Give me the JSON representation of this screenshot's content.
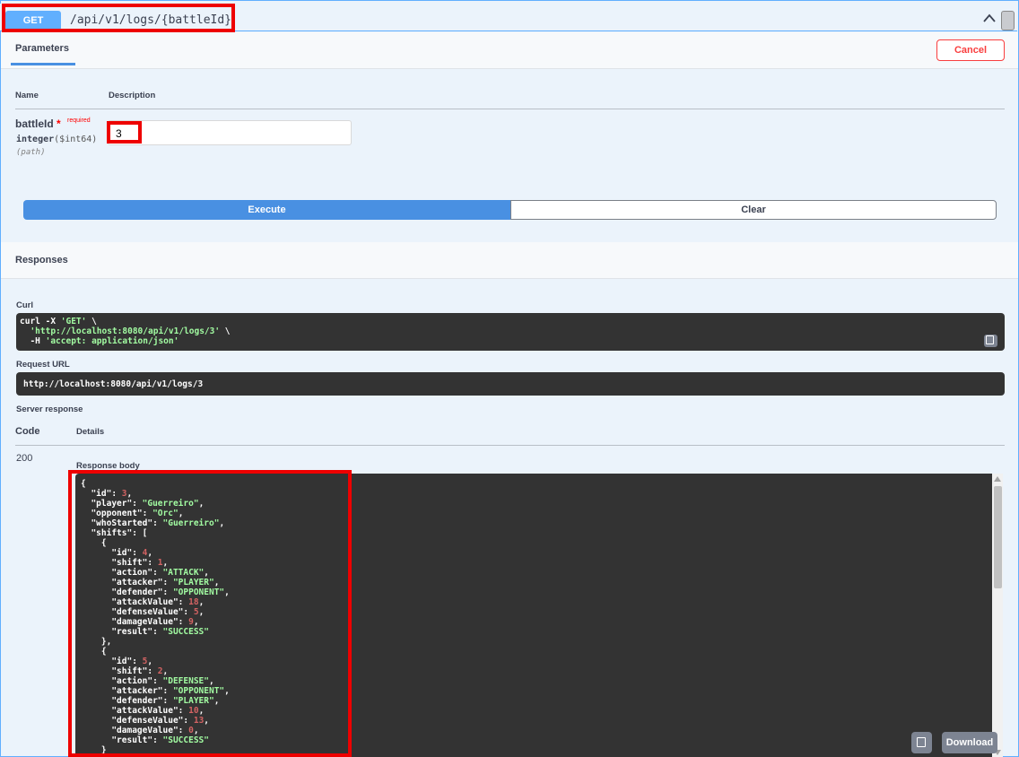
{
  "operation": {
    "method": "GET",
    "path": "/api/v1/logs/{battleId}"
  },
  "parameters": {
    "tab_label": "Parameters",
    "cancel_label": "Cancel",
    "col_name": "Name",
    "col_description": "Description",
    "param": {
      "name": "battleId",
      "required_star": "*",
      "required_label": "required",
      "type": "integer",
      "format": "($int64)",
      "location": "(path)",
      "value": "3"
    },
    "execute_label": "Execute",
    "clear_label": "Clear"
  },
  "responses": {
    "title": "Responses",
    "curl_label": "Curl",
    "curl_lines": [
      "curl -X 'GET' \\",
      "  'http://localhost:8080/api/v1/logs/3' \\",
      "  -H 'accept: application/json'"
    ],
    "request_url_label": "Request URL",
    "request_url": "http://localhost:8080/api/v1/logs/3",
    "server_response_label": "Server response",
    "code_header": "Code",
    "details_header": "Details",
    "code_value": "200",
    "response_body_label": "Response body",
    "download_label": "Download",
    "body": {
      "id": 3,
      "player": "Guerreiro",
      "opponent": "Orc",
      "whoStarted": "Guerreiro",
      "shifts": [
        {
          "id": 4,
          "shift": 1,
          "action": "ATTACK",
          "attacker": "PLAYER",
          "defender": "OPPONENT",
          "attackValue": 18,
          "defenseValue": 5,
          "damageValue": 9,
          "result": "SUCCESS"
        },
        {
          "id": 5,
          "shift": 2,
          "action": "DEFENSE",
          "attacker": "OPPONENT",
          "defender": "PLAYER",
          "attackValue": 10,
          "defenseValue": 13,
          "damageValue": 0,
          "result": "SUCCESS"
        }
      ]
    }
  },
  "colors": {
    "get_method": "#61affe",
    "execute": "#4990e2",
    "cancel": "#f93e3e",
    "highlight_box": "#ee0000",
    "json_string": "#a2fca2",
    "json_number": "#d36363"
  },
  "icons": [
    "chevron-up-icon",
    "copy-icon"
  ]
}
